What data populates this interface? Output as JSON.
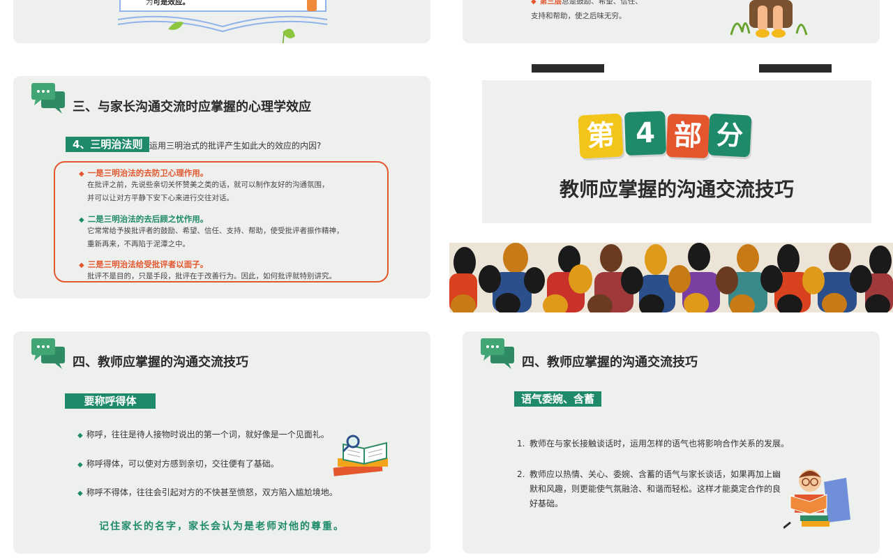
{
  "card1": {
    "fragment_prefix": "为",
    "fragment_bold": "可是效应。"
  },
  "card2": {
    "fragment_line1_bold": "第三层",
    "fragment_line1": "总是鼓励、希望、信任、",
    "fragment_line2": "支持和帮助，使之后味无穷。"
  },
  "card3": {
    "title": "三、与家长沟通交流时应掌握的心理学效应",
    "tag": "4、三明治法则",
    "question": "运用三明治式的批评产生如此大的效应的内因?",
    "items": [
      {
        "heading": "一是三明治法的去防卫心理作用。",
        "lines": [
          "在批评之前，先说些亲切关怀赞美之类的话，就可以制作友好的沟通氛围，",
          "并可以让对方平静下安下心来进行交往对话。"
        ]
      },
      {
        "heading": "二是三明治法的去后顾之忧作用。",
        "lines": [
          "它常常给予挨批评者的鼓励、希望、信任、支持、帮助，使受批评者振作精神，",
          "重新再来，不再陷于泥潭之中。"
        ]
      },
      {
        "heading": "三是三明治法给受批评者以面子。",
        "lines": [
          "批评不是目的，只是手段，批评在于改善行为。因此，如何批评就特别讲究。"
        ]
      }
    ]
  },
  "card4": {
    "chars": [
      "第",
      "4",
      "部",
      "分"
    ],
    "subtitle": "教师应掌握的沟通交流技巧"
  },
  "card5": {
    "title": "四、教师应掌握的沟通交流技巧",
    "tag": "要称呼得体",
    "bullets": [
      "称呼，往往是待人接物时说出的第一个词，就好像是一个见面礼。",
      "称呼得体，可以使对方感到亲切，交往便有了基础。",
      "称呼不得体，往往会引起对方的不快甚至愤怒，双方陷入尴尬境地。"
    ],
    "footer": "记住家长的名字，家长会认为是老师对他的尊重。"
  },
  "card6": {
    "title": "四、教师应掌握的沟通交流技巧",
    "tag": "语气委婉、含蓄",
    "items": [
      {
        "num": "1.",
        "lines": [
          "教师在与家长接触谈话时，运用怎样的语气也将影响合作关系的发展。"
        ]
      },
      {
        "num": "2.",
        "lines": [
          "教师应以热情、关心、委婉、含蓄的语气与家长谈话，如果再加上幽",
          "默和风趣，则更能使气氛融洽、和谐而轻松。这样才能奠定合作的良",
          "好基础。"
        ]
      }
    ]
  },
  "colors": {
    "green": "#1f8a6a",
    "orange_red": "#e4572e",
    "yellow": "#f3c51a",
    "card_bg": "#eef0ee"
  }
}
